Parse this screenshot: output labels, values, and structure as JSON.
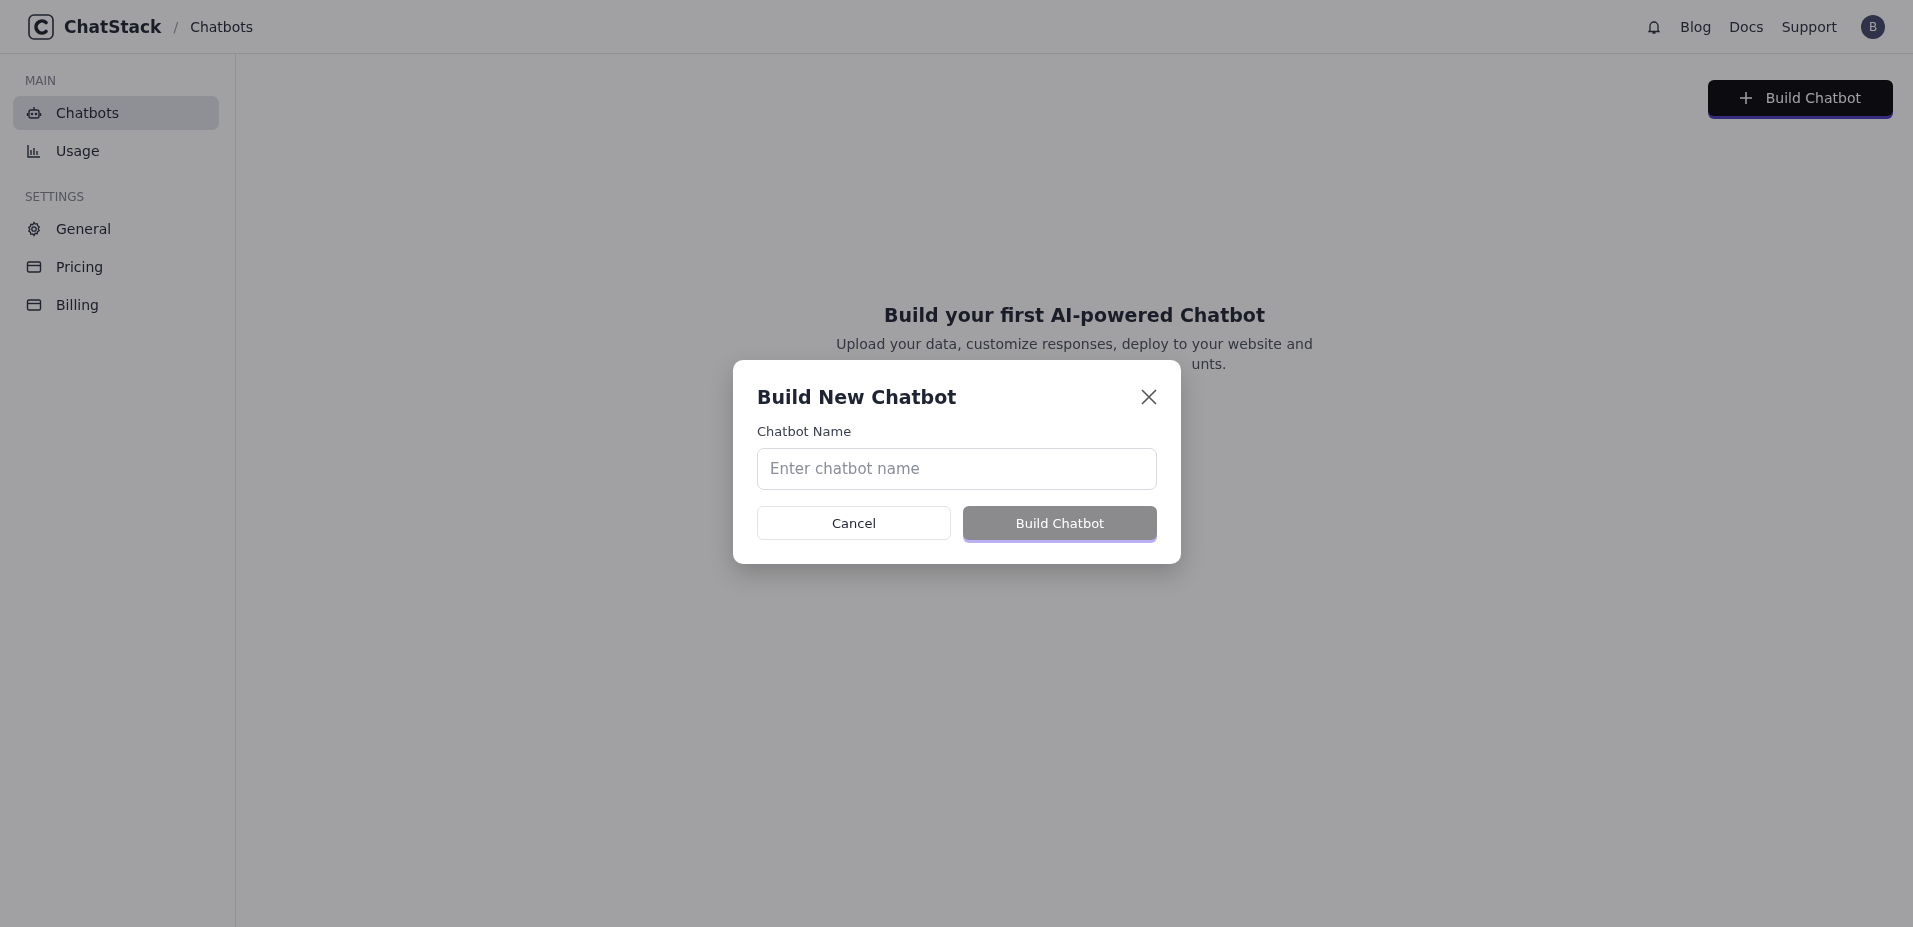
{
  "header": {
    "brand": "ChatStack",
    "separator": "/",
    "breadcrumb": "Chatbots",
    "links": [
      "Blog",
      "Docs",
      "Support"
    ],
    "avatar": "B"
  },
  "sidebar": {
    "sections": [
      {
        "title": "MAIN",
        "items": [
          {
            "label": "Chatbots",
            "selected": true
          },
          {
            "label": "Usage",
            "selected": false
          }
        ]
      },
      {
        "title": "SETTINGS",
        "items": [
          {
            "label": "General",
            "selected": false
          },
          {
            "label": "Pricing",
            "selected": false
          },
          {
            "label": "Billing",
            "selected": false
          }
        ]
      }
    ]
  },
  "main": {
    "build_button": "Build Chatbot",
    "empty_state": {
      "title": "Build your first AI-powered Chatbot",
      "lines": [
        "Upload your data, customize responses, deploy to your website and",
        "unts."
      ]
    }
  },
  "dialog": {
    "title": "Build New Chatbot",
    "field_label": "Chatbot Name",
    "placeholder": "Enter chatbot name",
    "cancel": "Cancel",
    "submit": {
      "label": "Build Chatbot",
      "disabled": true
    }
  }
}
